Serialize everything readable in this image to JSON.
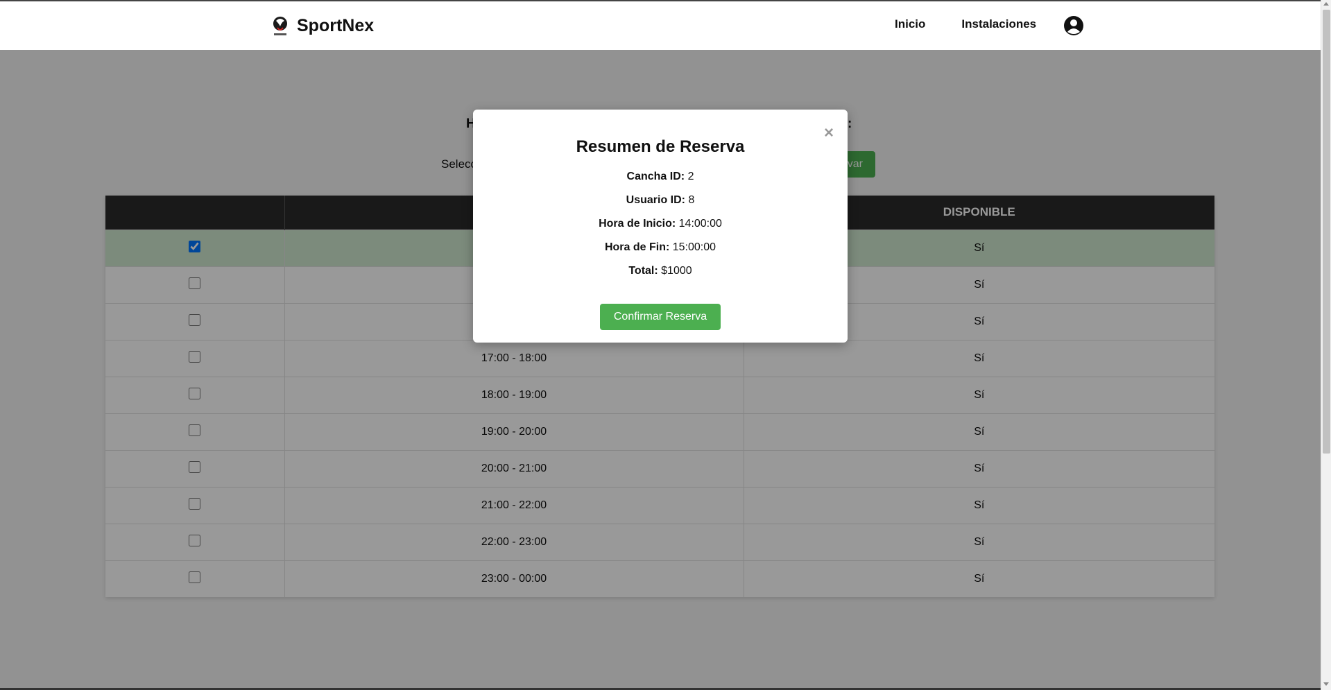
{
  "navbar": {
    "brand_name": "SportNex",
    "links": [
      "Inicio",
      "Instalaciones"
    ]
  },
  "page": {
    "title_partial_left": "H",
    "title_partial_right": ":",
    "select_label_partial": "Selecc",
    "reserve_button_partial": "var"
  },
  "table": {
    "headers": [
      "",
      "",
      "DISPONIBLE"
    ],
    "rows": [
      {
        "checked": true,
        "horario": "",
        "disponible": "Sí"
      },
      {
        "checked": false,
        "horario": "",
        "disponible": "Sí"
      },
      {
        "checked": false,
        "horario": "",
        "disponible": "Sí"
      },
      {
        "checked": false,
        "horario": "17:00 - 18:00",
        "disponible": "Sí"
      },
      {
        "checked": false,
        "horario": "18:00 - 19:00",
        "disponible": "Sí"
      },
      {
        "checked": false,
        "horario": "19:00 - 20:00",
        "disponible": "Sí"
      },
      {
        "checked": false,
        "horario": "20:00 - 21:00",
        "disponible": "Sí"
      },
      {
        "checked": false,
        "horario": "21:00 - 22:00",
        "disponible": "Sí"
      },
      {
        "checked": false,
        "horario": "22:00 - 23:00",
        "disponible": "Sí"
      },
      {
        "checked": false,
        "horario": "23:00 - 00:00",
        "disponible": "Sí"
      }
    ]
  },
  "modal": {
    "close": "×",
    "title": "Resumen de Reserva",
    "rows": [
      {
        "label": "Cancha ID:",
        "value": "2"
      },
      {
        "label": "Usuario ID:",
        "value": "8"
      },
      {
        "label": "Hora de Inicio:",
        "value": "14:00:00"
      },
      {
        "label": "Hora de Fin:",
        "value": "15:00:00"
      },
      {
        "label": "Total:",
        "value": "$1000"
      }
    ],
    "confirm_label": "Confirmar Reserva"
  },
  "colors": {
    "accent_green": "#4caf50",
    "header_dark": "#2a2a2a",
    "selected_row": "#cfe8cf"
  }
}
